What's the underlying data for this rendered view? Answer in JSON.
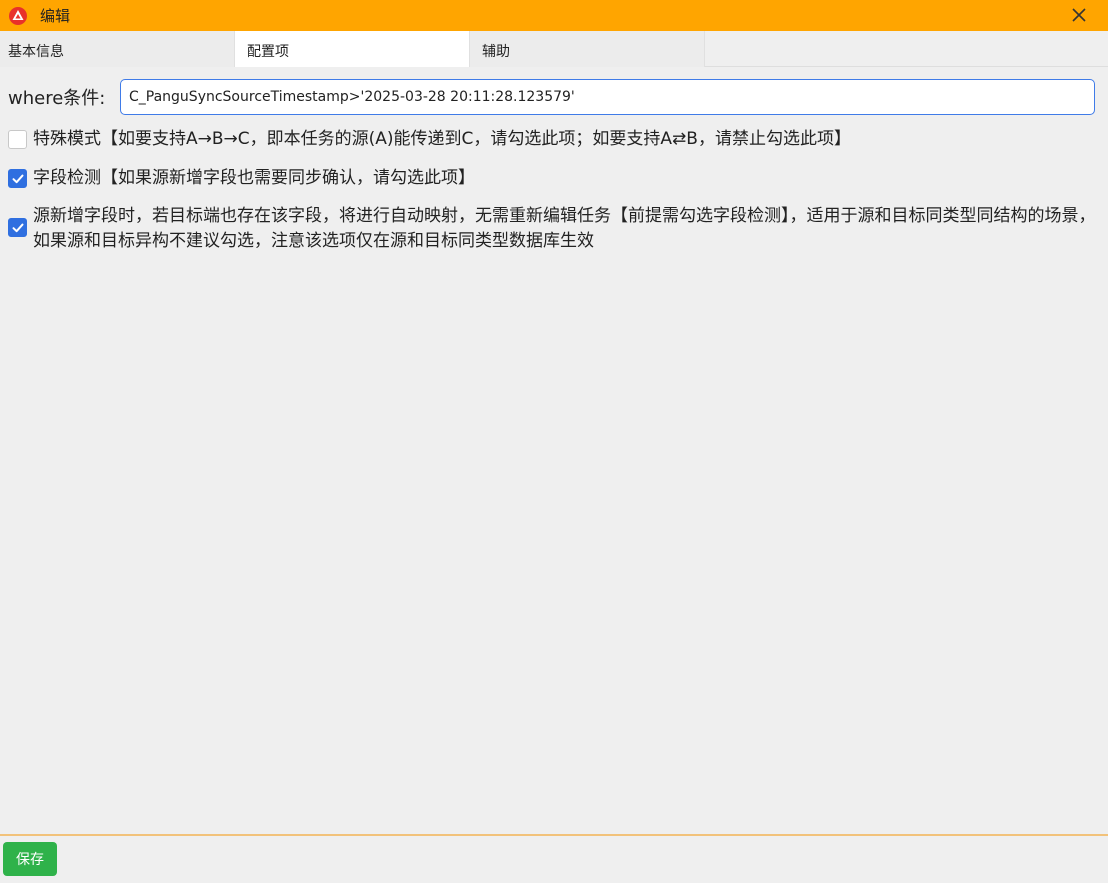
{
  "window": {
    "title": "编辑",
    "accent": "#ffa500"
  },
  "tabs": [
    {
      "label": "基本信息",
      "active": false
    },
    {
      "label": "配置项",
      "active": true
    },
    {
      "label": "辅助",
      "active": false
    }
  ],
  "where": {
    "label": "where条件:",
    "value": "C_PanguSyncSourceTimestamp>'2025-03-28 20:11:28.123579'"
  },
  "options": [
    {
      "label": "特殊模式【如要支持A→B→C，即本任务的源(A)能传递到C，请勾选此项；如要支持A⇄B，请禁止勾选此项】",
      "checked": false
    },
    {
      "label": "字段检测【如果源新增字段也需要同步确认，请勾选此项】",
      "checked": true
    },
    {
      "label": "源新增字段时，若目标端也存在该字段，将进行自动映射，无需重新编辑任务【前提需勾选字段检测】，适用于源和目标同类型同结构的场景，如果源和目标异构不建议勾选，注意该选项仅在源和目标同类型数据库生效",
      "checked": true
    }
  ],
  "footer": {
    "save_label": "保存"
  }
}
